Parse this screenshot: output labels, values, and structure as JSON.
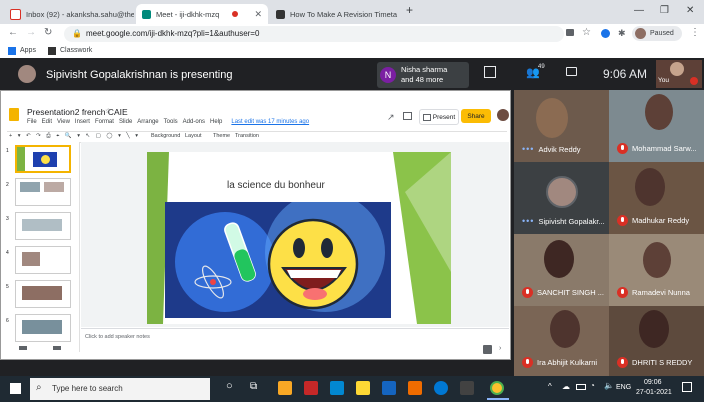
{
  "browser": {
    "tabs": [
      {
        "title": "Inbox (92) - akanksha.sahu@the",
        "favicon": "gmail"
      },
      {
        "title": "Meet - iji-dkhk-mzq",
        "favicon": "meet",
        "active": true
      },
      {
        "title": "How To Make A Revision Timeta",
        "favicon": "page"
      }
    ],
    "url": "meet.google.com/iji-dkhk-mzq?pli=1&authuser=0",
    "profile_label": "Paused",
    "bookmarks": [
      "Apps",
      "Classwork"
    ]
  },
  "meet": {
    "presenting_text": "Sipivisht Gopalakrishnan is presenting",
    "participants_name": "Nisha sharma",
    "participants_more": "and 48 more",
    "participant_initial": "N",
    "people_count": "49",
    "time": "9:06 AM",
    "self_label": "You",
    "tiles": [
      {
        "name": "Advik Reddy",
        "muted": false,
        "speaking": true
      },
      {
        "name": "Mohammad Sarw...",
        "muted": true
      },
      {
        "name": "Sipivisht Gopalakr...",
        "muted": false,
        "speaking": true
      },
      {
        "name": "Madhukar Reddy",
        "muted": true
      },
      {
        "name": "SANCHIT SINGH ...",
        "muted": true
      },
      {
        "name": "Ramadevi Nunna",
        "muted": true
      },
      {
        "name": "Ira Abhijit Kulkarni",
        "muted": true
      },
      {
        "name": "DHRITI S REDDY",
        "muted": true
      }
    ]
  },
  "slides": {
    "doc_title": "Presentation2 french CAIE",
    "menu": [
      "File",
      "Edit",
      "View",
      "Insert",
      "Format",
      "Slide",
      "Arrange",
      "Tools",
      "Add-ons",
      "Help"
    ],
    "last_edit": "Last edit was 17 minutes ago",
    "toolbar_items": [
      "Background",
      "Layout",
      "Theme",
      "Transition"
    ],
    "present_label": "Present",
    "share_label": "Share",
    "slide_title": "la science du bonheur",
    "speaker_notes_placeholder": "Click to add speaker notes",
    "slide_numbers": [
      "1",
      "2",
      "3",
      "4",
      "5",
      "6"
    ]
  },
  "taskbar": {
    "search_placeholder": "Type here to search",
    "language": "ENG",
    "time": "09:06",
    "date": "27-01-2021"
  },
  "colors": {
    "meet_bg": "#202124",
    "slide_green": "#7cb342",
    "share_yellow": "#fbbc04"
  }
}
